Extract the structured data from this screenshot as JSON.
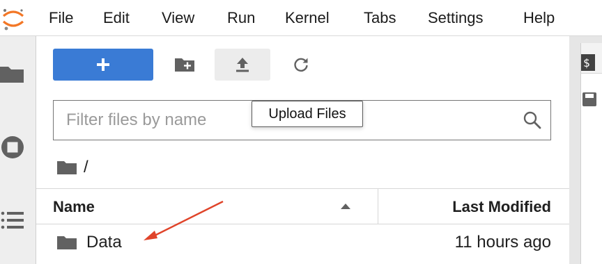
{
  "menubar": {
    "items": [
      "File",
      "Edit",
      "View",
      "Run",
      "Kernel",
      "Tabs",
      "Settings",
      "Help"
    ]
  },
  "toolbar": {
    "new_launcher_icon": "plus-icon",
    "new_folder_icon": "new-folder-icon",
    "upload_icon": "upload-icon",
    "refresh_icon": "refresh-icon",
    "upload_tooltip": "Upload Files"
  },
  "filter": {
    "placeholder": "Filter files by name",
    "value": ""
  },
  "breadcrumb": {
    "path": "/"
  },
  "file_list": {
    "columns": [
      "Name",
      "Last Modified"
    ],
    "rows": [
      {
        "name": "Data",
        "modified": "11 hours ago",
        "type": "folder"
      }
    ]
  },
  "colors": {
    "accent": "#3a7bd5",
    "logo_orange": "#f37726",
    "annotation_arrow": "#e0442a"
  }
}
